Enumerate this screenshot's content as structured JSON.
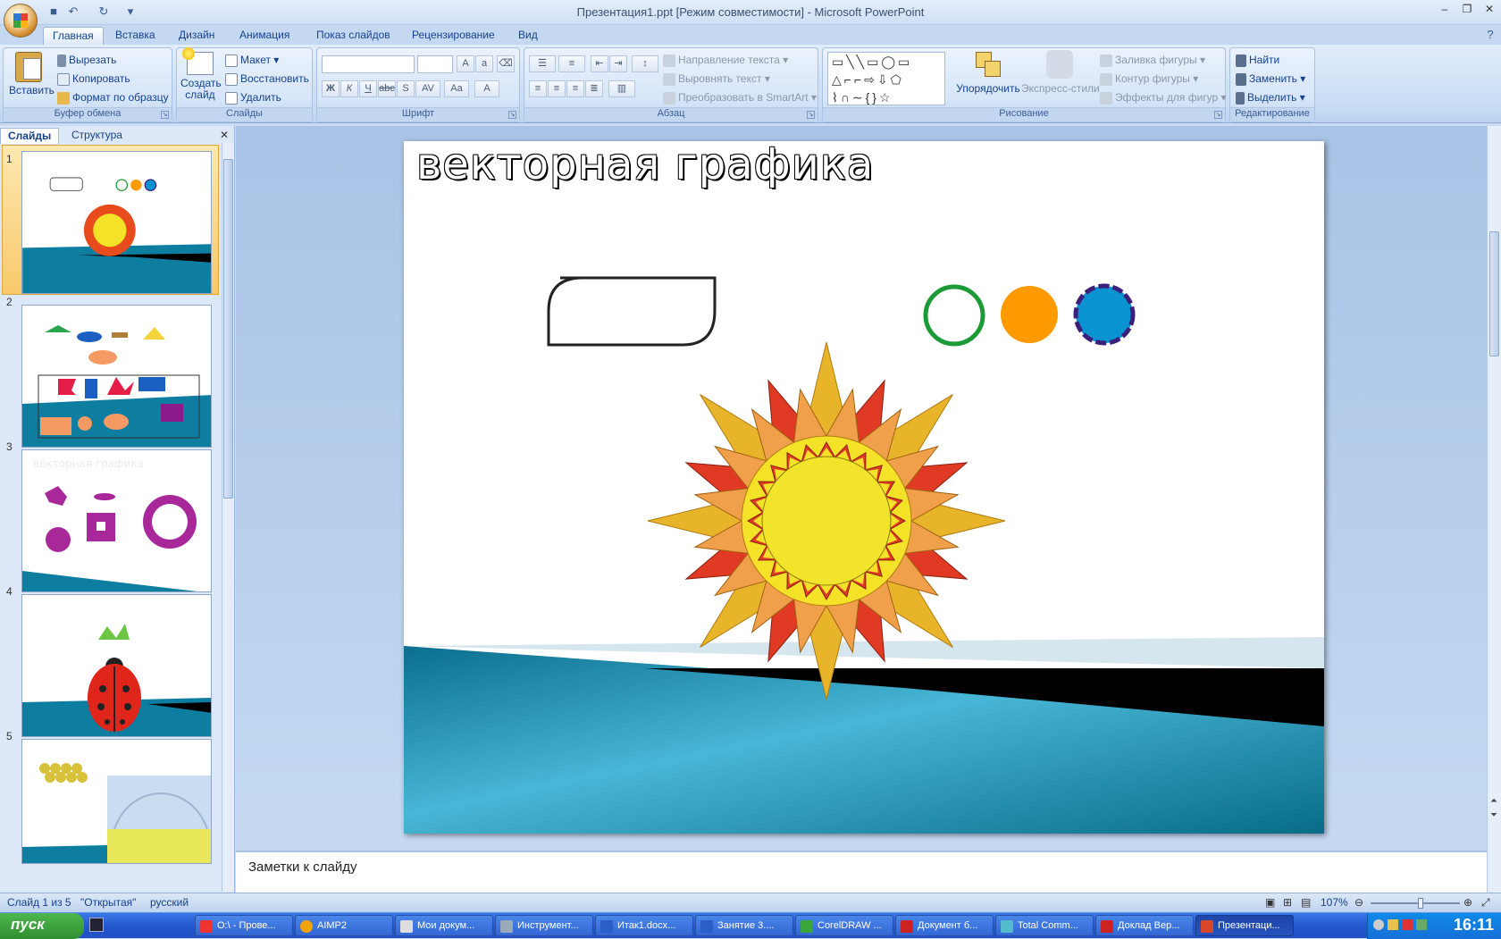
{
  "window": {
    "title": "Презентация1.ppt [Режим совместимости] - Microsoft PowerPoint"
  },
  "ribbon_tabs": [
    "Главная",
    "Вставка",
    "Дизайн",
    "Анимация",
    "Показ слайдов",
    "Рецензирование",
    "Вид"
  ],
  "clipboard": {
    "paste": "Вставить",
    "cut": "Вырезать",
    "copy": "Копировать",
    "format": "Формат по образцу",
    "label": "Буфер обмена"
  },
  "slides_group": {
    "new": "Создать слайд",
    "layout": "Макет",
    "reset": "Восстановить",
    "delete": "Удалить",
    "label": "Слайды"
  },
  "font_group": {
    "label": "Шрифт"
  },
  "paragraph_group": {
    "text_dir": "Направление текста",
    "align_text": "Выровнять текст",
    "smartart": "Преобразовать в SmartArt",
    "label": "Абзац"
  },
  "drawing_group": {
    "arrange": "Упорядочить",
    "quick_styles": "Экспресс-стили",
    "fill": "Заливка фигуры",
    "outline": "Контур фигуры",
    "effects": "Эффекты для фигур",
    "label": "Рисование"
  },
  "editing_group": {
    "find": "Найти",
    "replace": "Заменить",
    "select": "Выделить",
    "label": "Редактирование"
  },
  "panel_tabs": {
    "slides": "Слайды",
    "outline": "Структура"
  },
  "thumb_numbers": [
    "1",
    "2",
    "3",
    "4",
    "5"
  ],
  "thumb3_title": "векторная графика",
  "slide": {
    "title": "векторная графика"
  },
  "notes": "Заметки к слайду",
  "status": {
    "slide": "Слайд 1 из 5",
    "theme": "\"Открытая\"",
    "lang": "русский",
    "zoom": "107%"
  },
  "taskbar": {
    "start": "пуск",
    "items": [
      "O:\\ - Прове...",
      "AIMP2",
      "Мои докум...",
      "Инструмент...",
      "Итак1.docx...",
      "Занятие 3....",
      "CorelDRAW ...",
      "Документ б...",
      "Total Comm...",
      "Доклад Вер...",
      "Презентаци..."
    ],
    "clock": "16:11"
  }
}
